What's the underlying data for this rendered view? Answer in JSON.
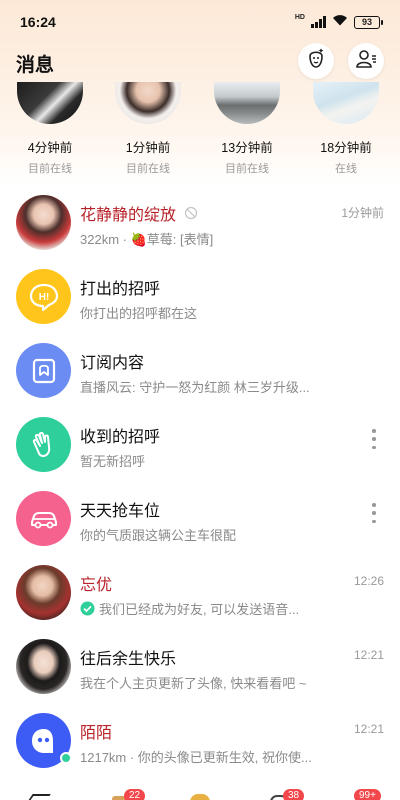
{
  "status_bar": {
    "time": "16:24",
    "network": "HD",
    "battery": "93"
  },
  "header": {
    "title": "消息"
  },
  "online_users": [
    {
      "time": "4分钟前",
      "status": "目前在线"
    },
    {
      "time": "1分钟前",
      "status": "目前在线"
    },
    {
      "time": "13分钟前",
      "status": "目前在线"
    },
    {
      "time": "18分钟前",
      "status": "在线"
    }
  ],
  "messages": [
    {
      "title": "花静静的绽放",
      "subtitle": "322km · 🍓草莓: [表情]",
      "time": "1分钟前"
    },
    {
      "title": "打出的招呼",
      "subtitle": "你打出的招呼都在这",
      "icon_text": "H!"
    },
    {
      "title": "订阅内容",
      "subtitle": "直播风云: 守护一怒为红颜 林三岁升级..."
    },
    {
      "title": "收到的招呼",
      "subtitle": "暂无新招呼"
    },
    {
      "title": "天天抢车位",
      "subtitle": "你的气质跟这辆公主车很配"
    },
    {
      "title": "忘优",
      "subtitle": "我们已经成为好友, 可以发送语音...",
      "time": "12:26"
    },
    {
      "title": "往后余生快乐",
      "subtitle": "我在个人主页更新了头像, 快来看看吧 ~",
      "time": "12:21"
    },
    {
      "title": "陌陌",
      "subtitle": "1217km · 你的头像已更新生效, 祝你使...",
      "time": "12:21"
    }
  ],
  "bottom_nav": {
    "badges": [
      "22",
      "38",
      "99+"
    ]
  },
  "colors": {
    "accent_red": "#b8232a",
    "greet_yellow": "#ffc51a",
    "subscribe_blue": "#6b8cf3",
    "received_green": "#2ecf9a",
    "car_pink": "#f6628e",
    "momo_blue": "#3d5cf5",
    "badge_red": "#f2484b"
  }
}
